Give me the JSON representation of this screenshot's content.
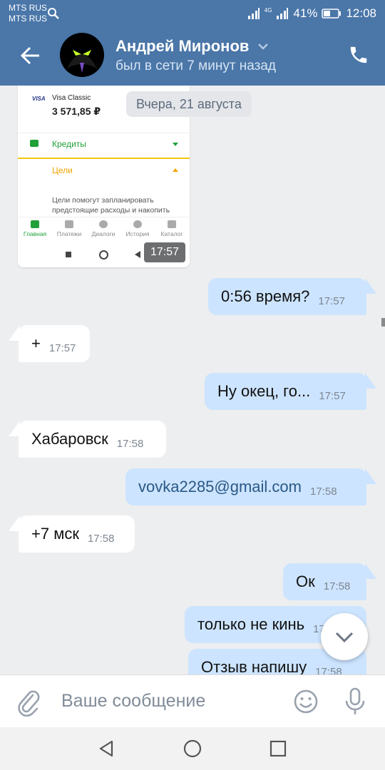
{
  "status_bar": {
    "operator1": "MTS RUS",
    "operator2": "MTS RUS",
    "network_type": "4G",
    "battery": "41%",
    "time": "12:08"
  },
  "header": {
    "contact_name": "Андрей Миронов",
    "status": "был в сети 7 минут назад"
  },
  "shared_screenshot": {
    "card_brand": "VISA",
    "card_name": "Visa Classic",
    "card_amount": "3 571,85 ₽",
    "row_credits": "Кредиты",
    "row_goals": "Цели",
    "goals_text": "Цели помогут запланировать предстоящие расходы и накопить",
    "tabs": [
      "Главная",
      "Платежи",
      "Диалоги",
      "История",
      "Каталог"
    ],
    "time": "17:57"
  },
  "date_separator": "Вчера, 21 августа",
  "messages": [
    {
      "dir": "out",
      "text": "0:56 время?",
      "time": "17:57"
    },
    {
      "dir": "in",
      "text": "+",
      "time": "17:57"
    },
    {
      "dir": "out",
      "text": "Ну окец, го...",
      "time": "17:57"
    },
    {
      "dir": "in",
      "text": "Хабаровск",
      "time": "17:58"
    },
    {
      "dir": "out",
      "text": "vovka2285@gmail.com",
      "time": "17:58"
    },
    {
      "dir": "in",
      "text": "+7 мск",
      "time": "17:58"
    },
    {
      "dir": "out",
      "text": "Ок",
      "time": "17:58"
    },
    {
      "dir": "out",
      "text": "только не кинь",
      "time": "17:58"
    },
    {
      "dir": "out",
      "text": "Отзыв напишу",
      "time": "17:58"
    }
  ],
  "input": {
    "placeholder": "Ваше сообщение"
  },
  "colors": {
    "header": "#4a76a8",
    "outgoing_bubble": "#cce4ff",
    "incoming_bubble": "#ffffff",
    "chat_background": "#edeef0"
  }
}
